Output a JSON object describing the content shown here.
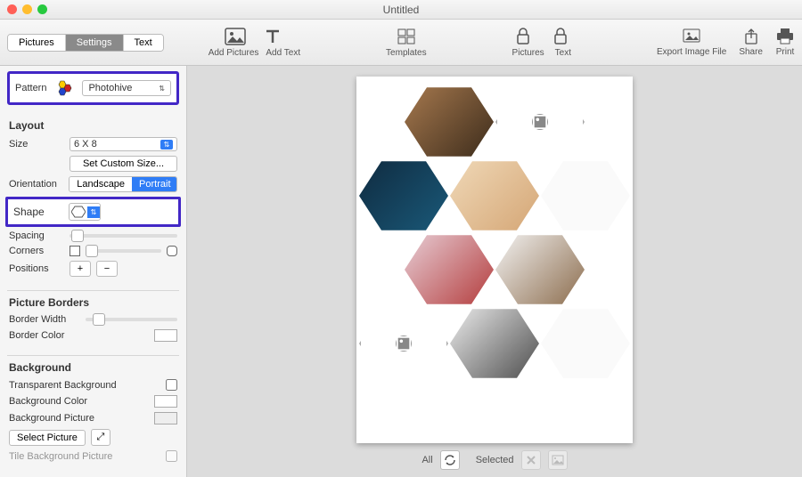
{
  "window": {
    "title": "Untitled"
  },
  "toolbar": {
    "tabs": [
      "Pictures",
      "Settings",
      "Text"
    ],
    "active_tab": 1,
    "add_pictures": "Add Pictures",
    "add_text": "Add Text",
    "templates": "Templates",
    "pictures": "Pictures",
    "text": "Text",
    "export": "Export Image File",
    "share": "Share",
    "print": "Print"
  },
  "pattern": {
    "label": "Pattern",
    "value": "Photohive"
  },
  "layout": {
    "heading": "Layout",
    "size_label": "Size",
    "size_value": "6 X 8",
    "custom_size": "Set Custom Size...",
    "orientation_label": "Orientation",
    "orientation_options": [
      "Landscape",
      "Portrait"
    ],
    "orientation_active": 1,
    "shape_label": "Shape",
    "spacing_label": "Spacing",
    "corners_label": "Corners",
    "positions_label": "Positions"
  },
  "borders": {
    "heading": "Picture Borders",
    "width_label": "Border Width",
    "color_label": "Border Color"
  },
  "background": {
    "heading": "Background",
    "transparent_label": "Transparent Background",
    "color_label": "Background Color",
    "picture_label": "Background Picture",
    "select_btn": "Select Picture",
    "tile_label": "Tile Background Picture"
  },
  "footer": {
    "all": "All",
    "selected": "Selected"
  }
}
